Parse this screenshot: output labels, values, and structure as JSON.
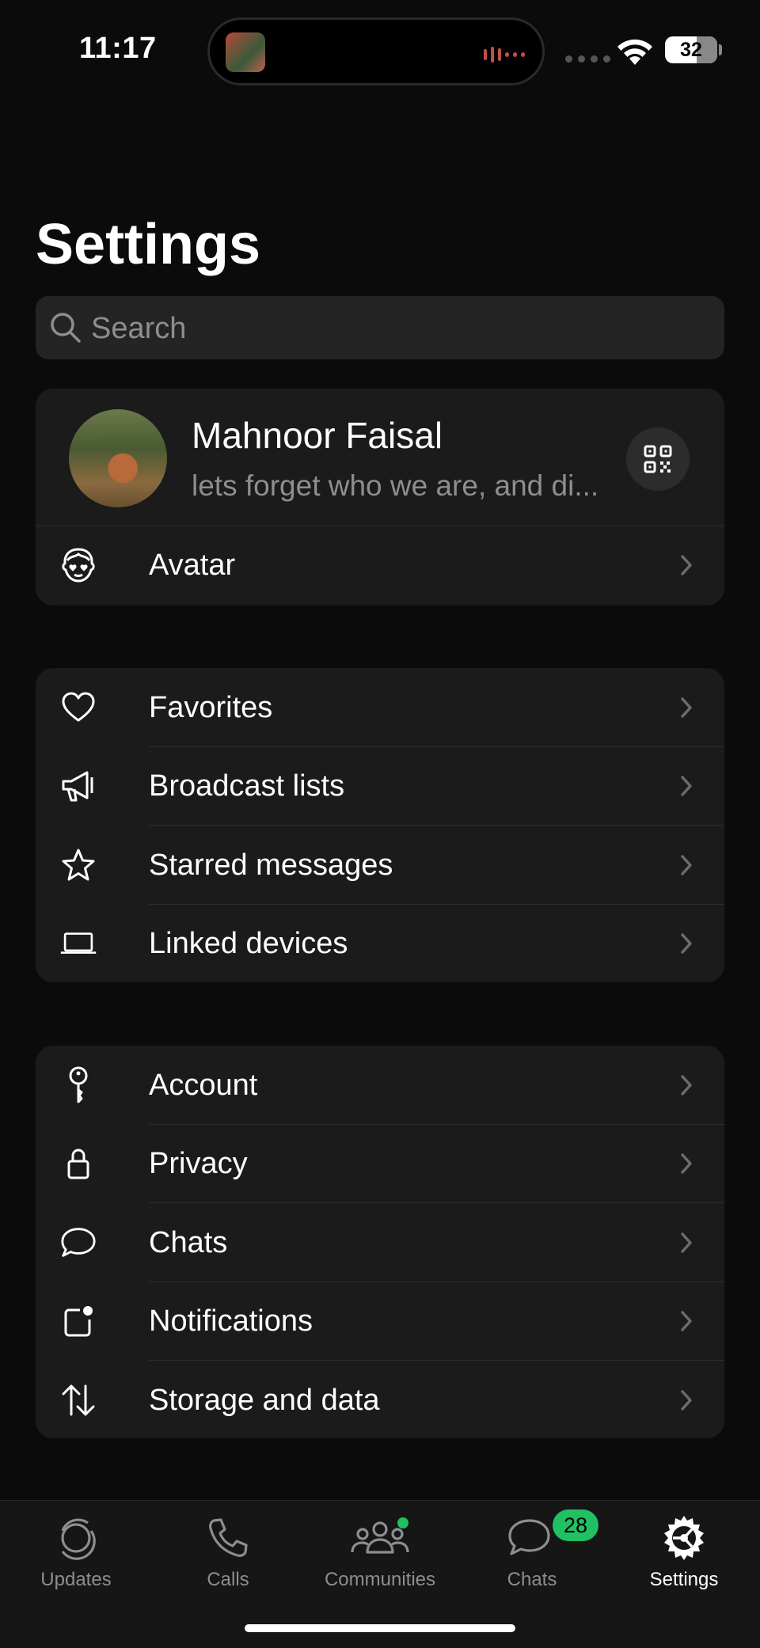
{
  "status_bar": {
    "time": "11:17",
    "battery": "32"
  },
  "page": {
    "title": "Settings"
  },
  "search": {
    "placeholder": "Search"
  },
  "profile": {
    "name": "Mahnoor Faisal",
    "status": "lets forget who we are, and di..."
  },
  "group0": [
    {
      "label": "Avatar",
      "icon": "avatar-icon"
    }
  ],
  "group1": [
    {
      "label": "Favorites",
      "icon": "heart-icon"
    },
    {
      "label": "Broadcast lists",
      "icon": "megaphone-icon"
    },
    {
      "label": "Starred messages",
      "icon": "star-icon"
    },
    {
      "label": "Linked devices",
      "icon": "laptop-icon"
    }
  ],
  "group2": [
    {
      "label": "Account",
      "icon": "key-icon"
    },
    {
      "label": "Privacy",
      "icon": "lock-icon"
    },
    {
      "label": "Chats",
      "icon": "chat-bubble-icon"
    },
    {
      "label": "Notifications",
      "icon": "notification-icon"
    },
    {
      "label": "Storage and data",
      "icon": "arrows-updown-icon"
    }
  ],
  "tabs": [
    {
      "label": "Updates",
      "icon": "updates-icon"
    },
    {
      "label": "Calls",
      "icon": "phone-icon"
    },
    {
      "label": "Communities",
      "icon": "communities-icon"
    },
    {
      "label": "Chats",
      "icon": "chats-icon",
      "badge": "28"
    },
    {
      "label": "Settings",
      "icon": "settings-gear-icon",
      "active": true
    }
  ],
  "colors": {
    "accent": "#21c063",
    "background": "#0b0b0b",
    "card": "#1b1b1b"
  }
}
